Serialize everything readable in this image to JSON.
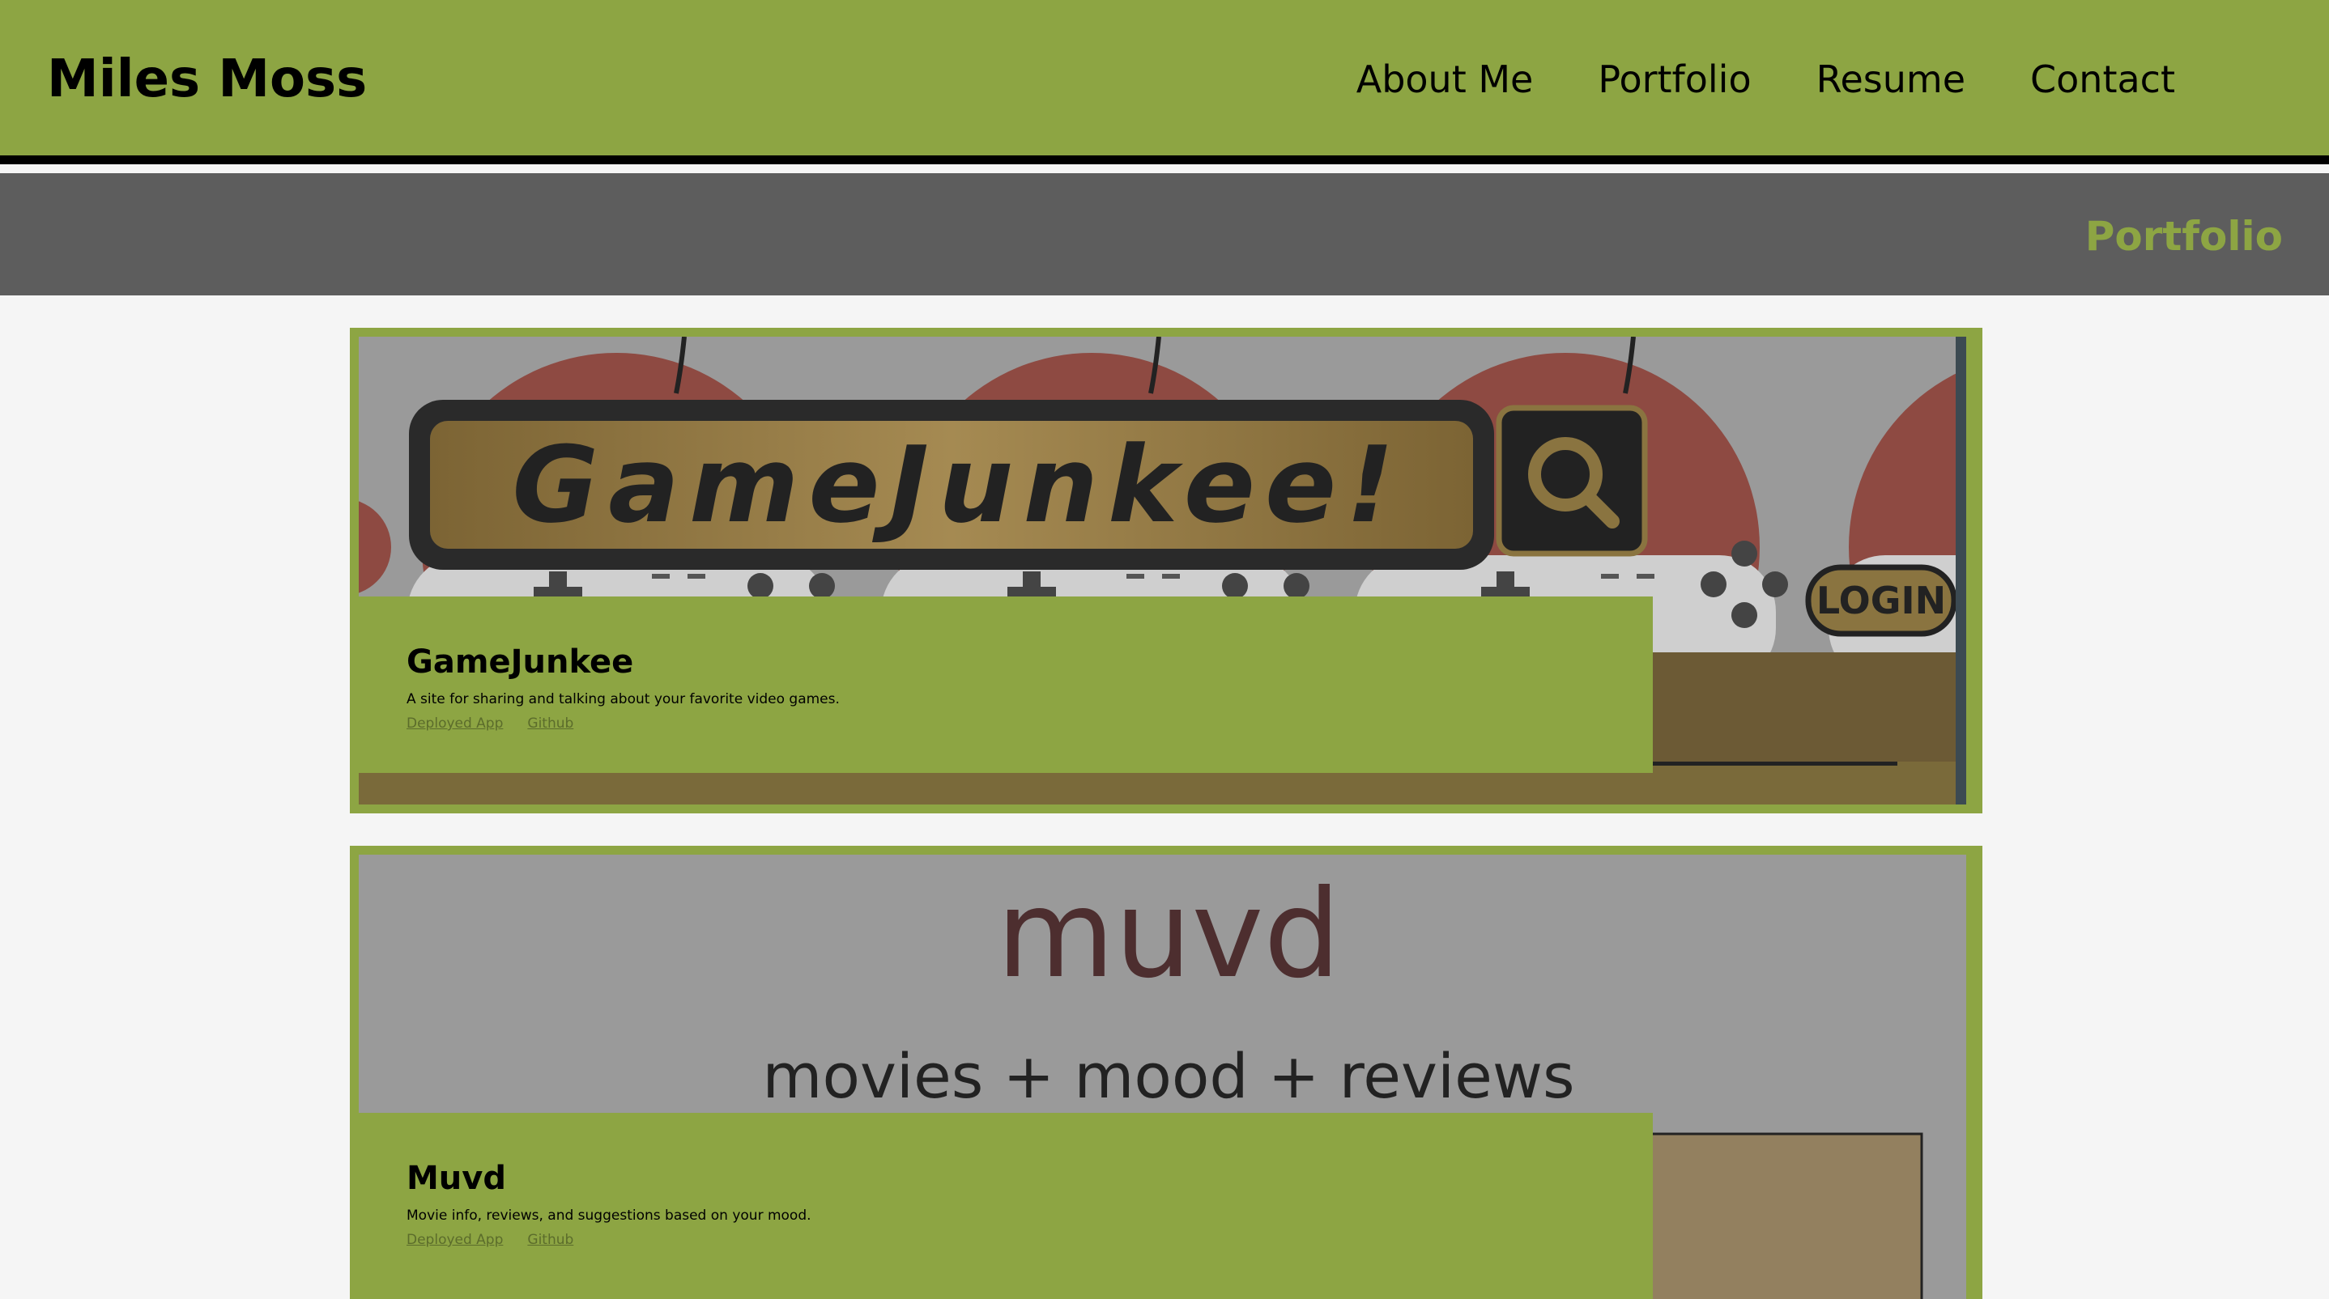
{
  "header": {
    "brand": "Miles Moss",
    "nav": [
      "About Me",
      "Portfolio",
      "Resume",
      "Contact"
    ]
  },
  "subheader": {
    "title": "Portfolio"
  },
  "projects": [
    {
      "screenshot_text": {
        "logo": "GameJunkee!",
        "login": "LOGIN"
      },
      "name": "GameJunkee",
      "description": "A site for sharing and talking about your favorite video games.",
      "deployed_label": "Deployed App",
      "github_label": "Github"
    },
    {
      "screenshot_text": {
        "logo": "muvd",
        "tagline": "movies + mood + reviews"
      },
      "name": "Muvd",
      "description": "Movie info, reviews, and suggestions based on your mood.",
      "deployed_label": "Deployed App",
      "github_label": "Github"
    }
  ],
  "colors": {
    "accent": "#8da543",
    "subheader_bg": "#5d5d5d",
    "page_bg": "#f5f5f5"
  }
}
